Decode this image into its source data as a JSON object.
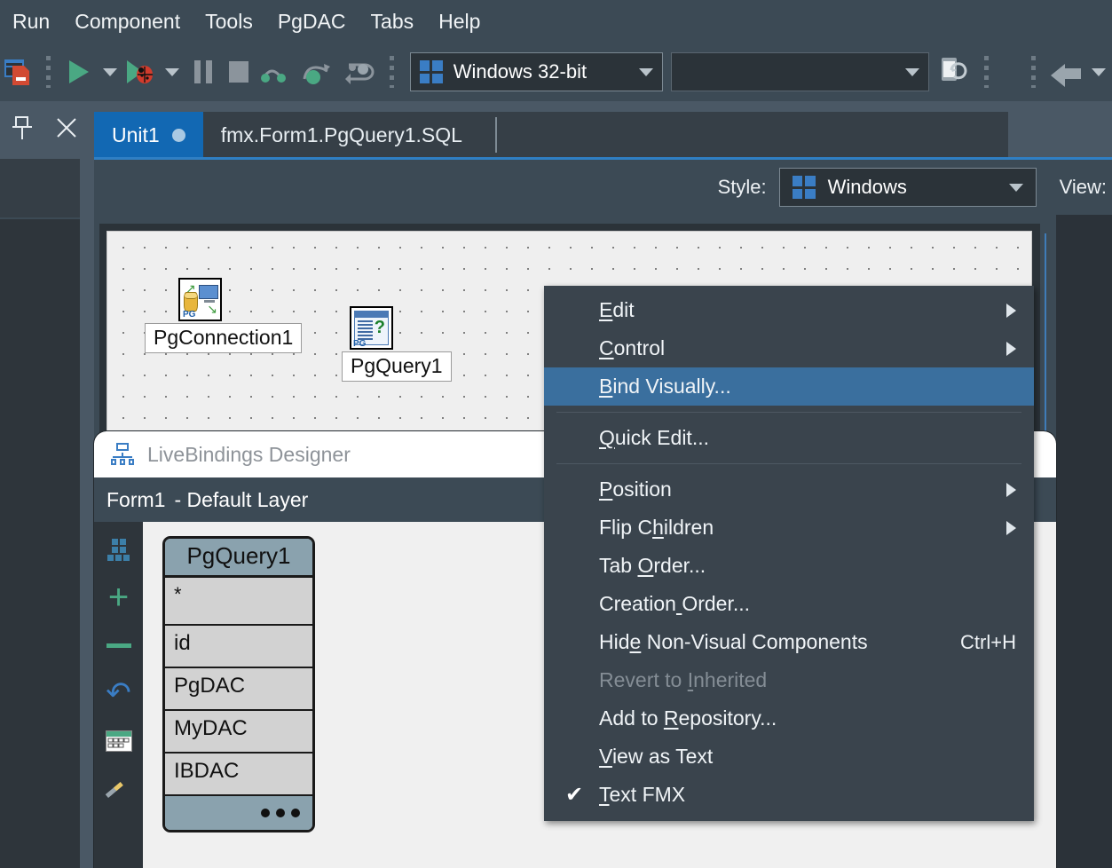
{
  "menubar": {
    "items": [
      {
        "label": "Run"
      },
      {
        "label": "Component"
      },
      {
        "label": "Tools"
      },
      {
        "label": "PgDAC"
      },
      {
        "label": "Tabs"
      },
      {
        "label": "Help"
      }
    ]
  },
  "toolbar": {
    "platform_combo": {
      "value": "Windows 32-bit",
      "icon": "windows-logo-icon"
    },
    "target_combo": {
      "value": "",
      "placeholder": ""
    },
    "icons": [
      "save-all-icon",
      "run-icon",
      "run-dropdown-icon",
      "run-debug-icon",
      "run-debug-dropdown-icon",
      "pause-icon",
      "stop-icon",
      "step-over-icon",
      "trace-into-icon",
      "run-to-cursor-icon",
      "mobile-refresh-icon",
      "back-arrow-icon",
      "back-dropdown-icon"
    ]
  },
  "tabs": {
    "pin_icon": "pin-icon",
    "close_icon": "close-icon",
    "items": [
      {
        "label": "Unit1",
        "active": true,
        "modified": true
      },
      {
        "label": "fmx.Form1.PgQuery1.SQL",
        "active": false,
        "modified": false
      }
    ]
  },
  "designer_header": {
    "style_label": "Style:",
    "style_value": "Windows",
    "style_icon": "windows-logo-icon",
    "view_label": "View:"
  },
  "form": {
    "components": [
      {
        "name": "PgConnection1",
        "icon": "pg-connection-icon"
      },
      {
        "name": "PgQuery1",
        "icon": "pg-query-icon"
      }
    ]
  },
  "livebindings": {
    "title": "LiveBindings Designer",
    "title_icon": "livebindings-icon",
    "form_name": "Form1",
    "layer_name": "- Default Layer",
    "rail_icons": [
      "bindings-grid-icon",
      "add-icon",
      "remove-icon",
      "undo-icon",
      "live-data-icon",
      "wizard-wand-icon"
    ],
    "node": {
      "title": "PgQuery1",
      "fields": [
        "*",
        "id",
        "PgDAC",
        "MyDAC",
        "IBDAC"
      ],
      "more_indicator": "•••"
    }
  },
  "context_menu": {
    "items": [
      {
        "label": "Edit",
        "accel_index": 0,
        "submenu": true,
        "type": "item"
      },
      {
        "label": "Control",
        "accel_index": 0,
        "submenu": true,
        "type": "item"
      },
      {
        "label": "Bind Visually...",
        "accel_index": 0,
        "submenu": false,
        "type": "item",
        "selected": true
      },
      {
        "type": "separator"
      },
      {
        "label": "Quick Edit...",
        "accel_index": 0,
        "submenu": false,
        "type": "item"
      },
      {
        "type": "separator"
      },
      {
        "label": "Position",
        "accel_index": 0,
        "submenu": true,
        "type": "item"
      },
      {
        "label": "Flip Children",
        "accel_index": 6,
        "submenu": true,
        "type": "item"
      },
      {
        "label": "Tab Order...",
        "accel_index": 4,
        "submenu": false,
        "type": "item"
      },
      {
        "label": "Creation Order...",
        "accel_index": 8,
        "submenu": false,
        "type": "item"
      },
      {
        "label": "Hide Non-Visual Components",
        "accel_index": 3,
        "submenu": false,
        "type": "item",
        "shortcut": "Ctrl+H"
      },
      {
        "label": "Revert to Inherited",
        "accel_index": 10,
        "submenu": false,
        "type": "item",
        "disabled": true
      },
      {
        "label": "Add to Repository...",
        "accel_index": 7,
        "submenu": false,
        "type": "item"
      },
      {
        "label": "View as Text",
        "accel_index": 0,
        "submenu": false,
        "type": "item"
      },
      {
        "label": "Text FMX",
        "accel_index": 0,
        "submenu": false,
        "type": "item",
        "checked": true
      }
    ],
    "check_glyph": "✔"
  },
  "colors": {
    "chrome": "#3c4a55",
    "panel_dark": "#2e353b",
    "tab_active": "#1268b3",
    "menu_bg": "#3a444d",
    "menu_selected": "#3a6f9e",
    "accent_blue": "#3a7dc4",
    "accent_green": "#4aa883"
  }
}
